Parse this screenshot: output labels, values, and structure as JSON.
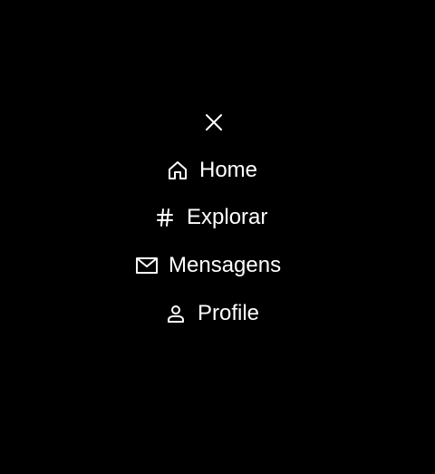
{
  "menu": {
    "close_icon": "close-icon",
    "items": [
      {
        "label": "Home",
        "icon": "home-icon"
      },
      {
        "label": "Explorar",
        "icon": "hashtag-icon"
      },
      {
        "label": "Mensagens",
        "icon": "mail-icon"
      },
      {
        "label": "Profile",
        "icon": "user-icon"
      }
    ]
  },
  "colors": {
    "background": "#000000",
    "foreground": "#ffffff"
  }
}
